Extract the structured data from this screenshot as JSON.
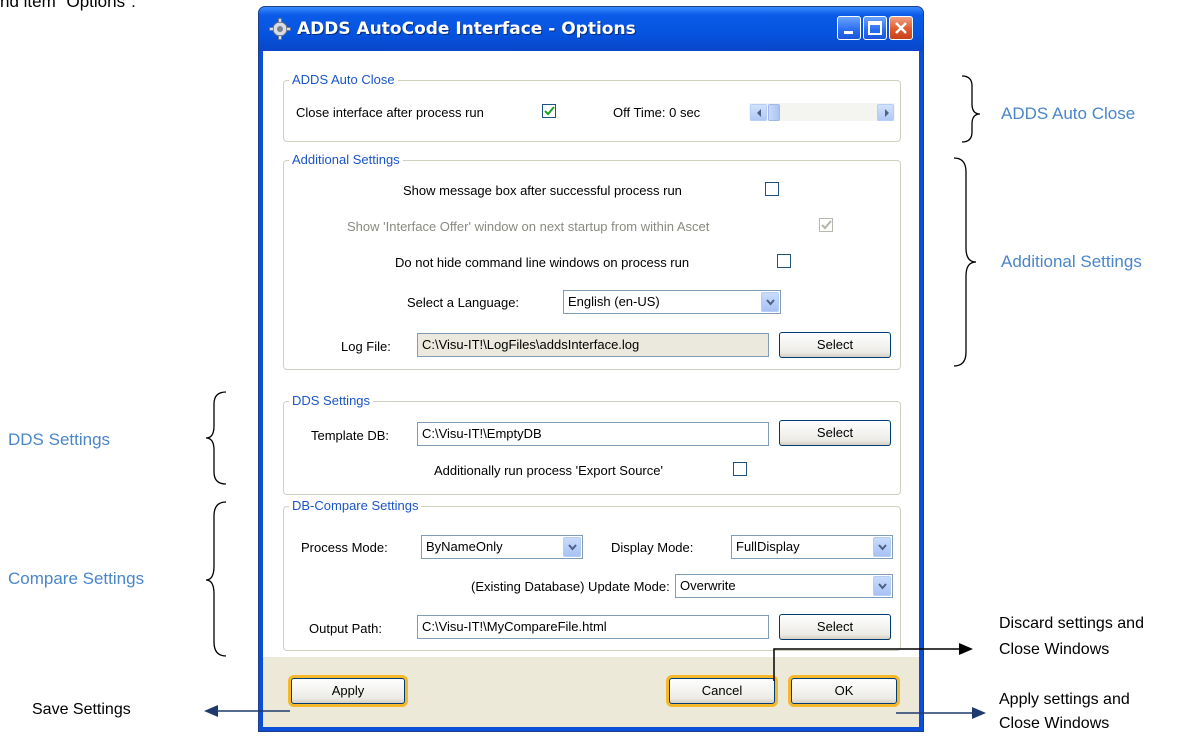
{
  "page_caption": "nd item \"Options\".",
  "window": {
    "title": "ADDS AutoCode Interface - Options"
  },
  "auto_close": {
    "legend": "ADDS Auto Close",
    "close_label": "Close interface after process run",
    "close_checked": true,
    "off_time_label": "Off Time: 0 sec"
  },
  "additional": {
    "legend": "Additional Settings",
    "show_message_label": "Show message box after successful process run",
    "show_offer_label": "Show 'Interface Offer' window on next startup from within Ascet",
    "hide_cmd_label": "Do not hide command line windows on process run",
    "language_label": "Select a Language:",
    "language_value": "English (en-US)",
    "log_file_label": "Log File:",
    "log_file_value": "C:\\Visu-IT!\\LogFiles\\addsInterface.log",
    "select_label": "Select"
  },
  "dds": {
    "legend": "DDS Settings",
    "template_label": "Template DB:",
    "template_value": "C:\\Visu-IT!\\EmptyDB",
    "select_label": "Select",
    "export_label": "Additionally run process 'Export Source'"
  },
  "compare": {
    "legend": "DB-Compare Settings",
    "process_mode_label": "Process Mode:",
    "process_mode_value": "ByNameOnly",
    "display_mode_label": "Display Mode:",
    "display_mode_value": "FullDisplay",
    "update_mode_label": "(Existing Database) Update Mode:",
    "update_mode_value": "Overwrite",
    "output_label": "Output Path:",
    "output_value": "C:\\Visu-IT!\\MyCompareFile.html",
    "select_label": "Select"
  },
  "buttons": {
    "apply": "Apply",
    "cancel": "Cancel",
    "ok": "OK"
  },
  "annotations": {
    "auto_close": "ADDS Auto Close",
    "additional": "Additional Settings",
    "dds": "DDS Settings",
    "compare": "Compare Settings",
    "save": "Save Settings",
    "discard_line1": "Discard settings and",
    "discard_line2": "Close Windows",
    "apply_line1": "Apply settings and",
    "apply_line2": "Close Windows"
  },
  "colors": {
    "titlebar": "#0554e0",
    "annotation_blue": "#4a86c8",
    "legend_blue": "#1b55c8",
    "highlight": "#f5b82a",
    "check_green": "#21a121"
  }
}
